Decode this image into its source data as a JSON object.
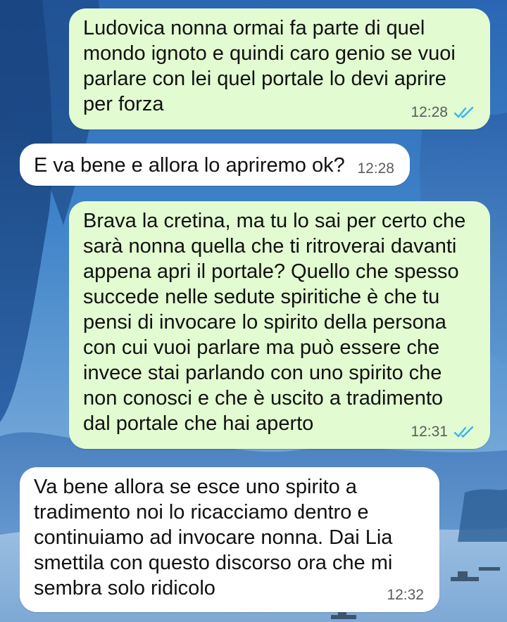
{
  "messages": [
    {
      "direction": "out",
      "text": "Ludovica nonna ormai fa parte  di quel mondo ignoto e quindi caro genio se vuoi parlare con lei quel portale lo devi aprire per forza",
      "time": "12:28",
      "status_icon": "double-check-read-icon"
    },
    {
      "direction": "in",
      "text": "E va bene e allora lo apriremo ok?",
      "time": "12:28"
    },
    {
      "direction": "out",
      "text": "Brava la cretina, ma tu lo sai per certo che sarà nonna quella che ti ritroverai davanti appena apri il portale?  Quello che spesso succede nelle sedute spiritiche è che tu pensi di invocare lo spirito della persona con cui vuoi parlare ma può essere che invece stai parlando con uno spirito che non conosci e che è uscito a tradimento dal portale che hai aperto",
      "time": "12:31",
      "status_icon": "double-check-read-icon"
    },
    {
      "direction": "in",
      "text": "Va bene allora se esce uno spirito a tradimento noi lo ricacciamo dentro e continuiamo ad invocare nonna. Dai Lia smettila con questo discorso ora che mi sembra solo ridicolo",
      "time": "12:32"
    }
  ],
  "colors": {
    "outgoing_bubble": "#e2fbd1",
    "incoming_bubble": "#ffffff",
    "read_check": "#34b7f1",
    "timestamp": "#5c5c5c"
  }
}
